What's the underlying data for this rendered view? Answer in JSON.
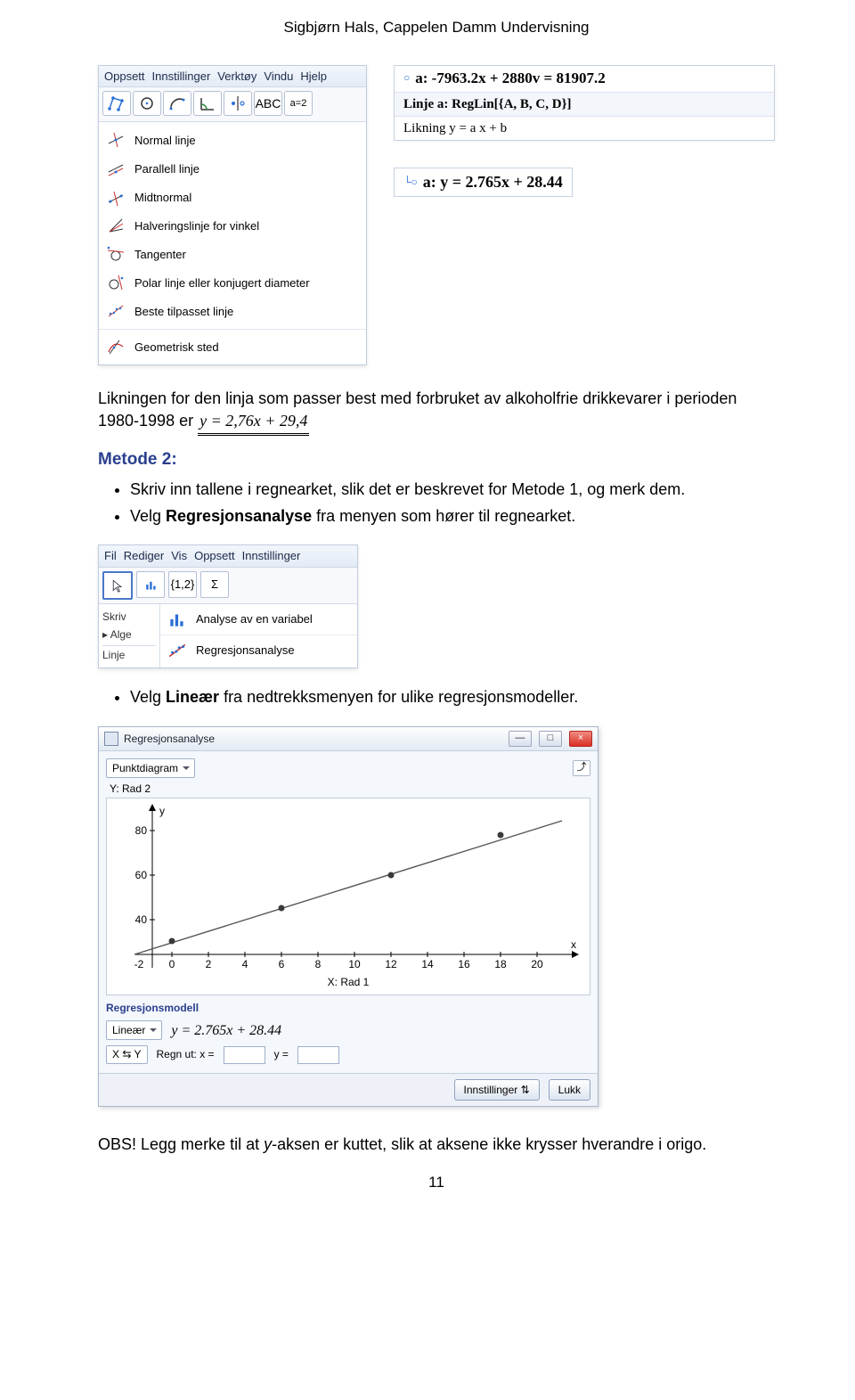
{
  "header": "Sigbjørn Hals, Cappelen Damm Undervisning",
  "ggb_menu": {
    "menubar": [
      "Oppsett",
      "Innstillinger",
      "Verktøy",
      "Vindu",
      "Hjelp"
    ],
    "toolbar_text": [
      "ABC",
      "a=2"
    ],
    "items": [
      "Normal linje",
      "Parallell linje",
      "Midtnormal",
      "Halveringslinje for vinkel",
      "Tangenter",
      "Polar linje eller konjugert diameter",
      "Beste tilpasset linje",
      "Geometrisk sted"
    ]
  },
  "eq_box": {
    "line1": "a: -7963.2x + 2880v = 81907.2",
    "line2": "Linje a: RegLin[{A, B, C, D}]",
    "line3": "Likning y = a x + b"
  },
  "eq_small": "a: y = 2.765x + 28.44",
  "intro": {
    "p1a": "Likningen for den linja som passer best med forbruket av alkoholfrie drikkevarer i perioden 1980-1998 er ",
    "eq": "y = 2,76x + 29,4"
  },
  "metode2": {
    "title": "Metode 2:",
    "b1": "Skriv inn tallene i regnearket, slik det er beskrevet for Metode 1, og merk dem.",
    "b2a": "Velg ",
    "b2b": "Regresjonsanalyse",
    "b2c": " fra menyen som hører til regnearket."
  },
  "mini": {
    "menubar": [
      "Fil",
      "Rediger",
      "Vis",
      "Oppsett",
      "Innstillinger"
    ],
    "tools": [
      "",
      "",
      "{1,2}",
      "Σ"
    ],
    "left": [
      "Skriv",
      "▸ Alge",
      "Linje"
    ],
    "row1": "Analyse av en variabel",
    "row2": "Regresjonsanalyse"
  },
  "bullet3a": "Velg ",
  "bullet3b": "Lineær",
  "bullet3c": " fra nedtrekksmenyen for ulike regresjonsmodeller.",
  "regwin": {
    "title": "Regresjonsanalyse",
    "plot_type": "Punktdiagram",
    "ylabel": "Y: Rad 2",
    "xlabel": "X: Rad 1",
    "reg_label": "Regresjonsmodell",
    "model": "Lineær",
    "formula": "y = 2.765x + 28.44",
    "swap": "X ⇆ Y",
    "calc": "Regn ut:  x =",
    "ytxt": "y =",
    "settings": "Innstillinger ⇅",
    "close": "Lukk"
  },
  "chart_data": {
    "type": "scatter",
    "x": [
      0,
      6,
      12,
      18
    ],
    "y": [
      30,
      45,
      60,
      78
    ],
    "xlim": [
      -2,
      20
    ],
    "ylim": [
      20,
      85
    ],
    "xticks": [
      -2,
      0,
      2,
      4,
      6,
      8,
      10,
      12,
      14,
      16,
      18,
      20
    ],
    "yticks": [
      40,
      60,
      80
    ],
    "xlabel": "X: Rad 1",
    "ylabel": "Y: Rad 2",
    "y_axis_name": "y",
    "x_axis_name": "x"
  },
  "obs": {
    "p1": "OBS! Legg merke til at ",
    "em": "y",
    "p2": "-aksen er kuttet, slik at aksene ikke krysser hverandre i origo."
  },
  "page_num": "11"
}
